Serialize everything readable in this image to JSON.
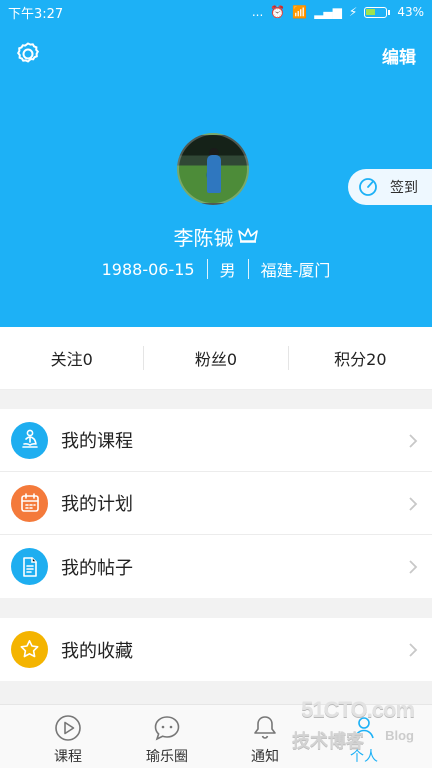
{
  "status": {
    "time": "下午3:27",
    "dots": "...",
    "battery": "43%"
  },
  "header": {
    "edit_label": "编辑",
    "checkin_label": "签到",
    "name": "李陈铖",
    "birthdate": "1988-06-15",
    "gender": "男",
    "location": "福建-厦门"
  },
  "stats": [
    {
      "label": "关注",
      "value": "0"
    },
    {
      "label": "粉丝",
      "value": "0"
    },
    {
      "label": "积分",
      "value": "20"
    }
  ],
  "menu": [
    {
      "label": "我的课程"
    },
    {
      "label": "我的计划"
    },
    {
      "label": "我的帖子"
    },
    {
      "label": "我的收藏"
    }
  ],
  "nav": [
    {
      "label": "课程"
    },
    {
      "label": "瑜乐圈"
    },
    {
      "label": "通知"
    },
    {
      "label": "个人"
    }
  ],
  "watermark": {
    "logo": "51CTO.com",
    "text": "技术博客",
    "blog": "Blog"
  },
  "colors": {
    "primary": "#1db1f6",
    "course_icon": "#1eaef0",
    "plan_icon": "#f47a3b",
    "posts_icon": "#1eaef0",
    "favorites_icon": "#f4b400"
  }
}
